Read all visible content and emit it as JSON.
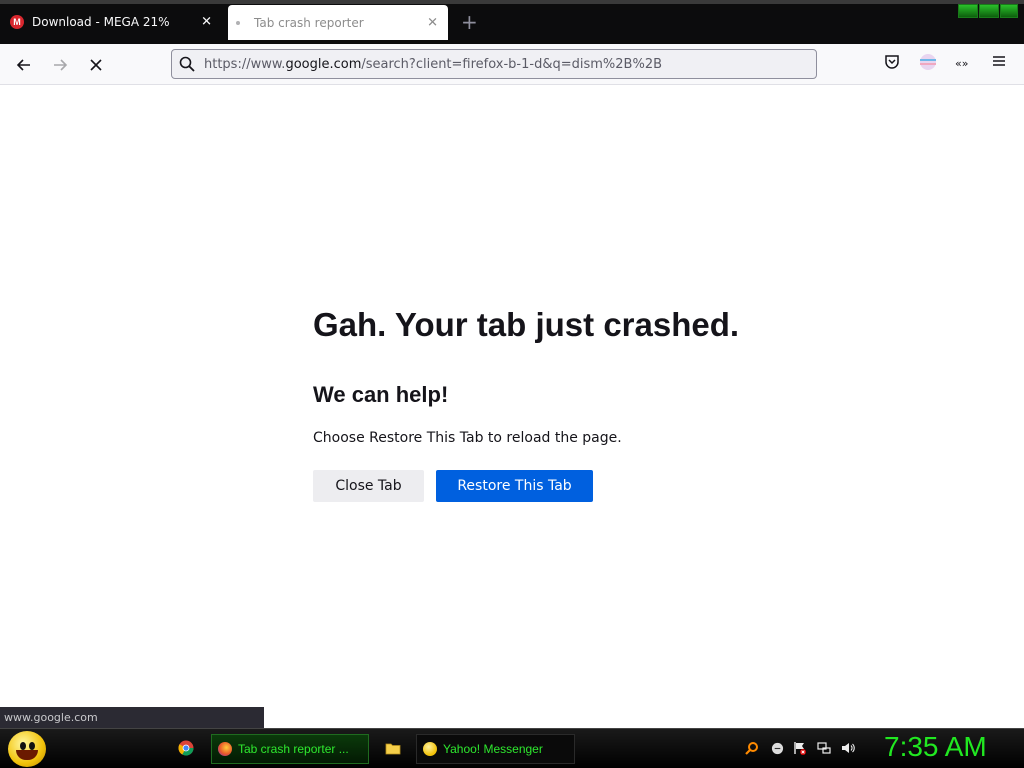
{
  "tabs": [
    {
      "title": "Download - MEGA 21%",
      "active": false
    },
    {
      "title": "Tab crash reporter",
      "active": true
    }
  ],
  "navbar": {
    "url_prefix": "https://www.",
    "url_host": "google.com",
    "url_path": "/search?client=firefox-b-1-d&q=dism%2B%2B"
  },
  "crash": {
    "title": "Gah. Your tab just crashed.",
    "subtitle": "We can help!",
    "description": "Choose Restore This Tab to reload the page.",
    "close_button": "Close Tab",
    "restore_button": "Restore This Tab"
  },
  "status": {
    "text": "www.google.com"
  },
  "taskbar": {
    "tasks": [
      {
        "label": "Tab crash reporter ..."
      },
      {
        "label": "Yahoo! Messenger"
      }
    ],
    "clock": "7:35 AM"
  },
  "colors": {
    "primary_button": "#0060df",
    "clock": "#21e821",
    "mega": "#d9272e"
  }
}
